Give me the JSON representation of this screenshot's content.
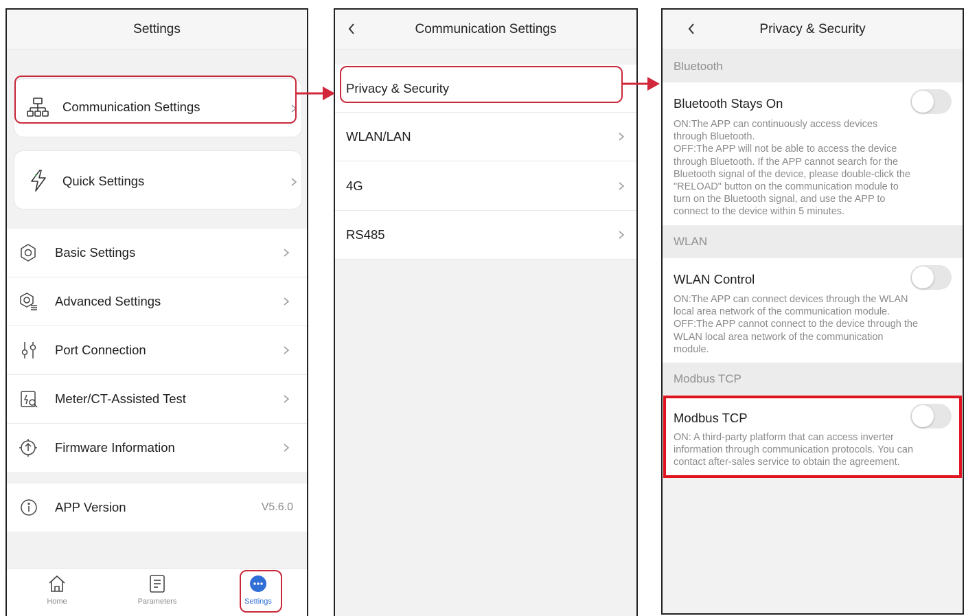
{
  "colors": {
    "highlight": "#c8283a",
    "accent": "#2f6fd6",
    "arrow": "#d2263a"
  },
  "screen1": {
    "title": "Settings",
    "card_items": [
      {
        "icon": "network-icon",
        "label": "Communication Settings"
      },
      {
        "icon": "lightning-icon",
        "label": "Quick Settings"
      }
    ],
    "list_items": [
      {
        "icon": "gear-icon",
        "label": "Basic Settings"
      },
      {
        "icon": "advanced-gear-icon",
        "label": "Advanced Settings"
      },
      {
        "icon": "port-connection-icon",
        "label": "Port Connection"
      },
      {
        "icon": "meter-test-icon",
        "label": "Meter/CT-Assisted Test"
      },
      {
        "icon": "firmware-icon",
        "label": "Firmware Information"
      }
    ],
    "app_version": {
      "label": "APP Version",
      "value": "V5.6.0"
    },
    "tabs": [
      {
        "icon": "home-icon",
        "label": "Home",
        "active": false
      },
      {
        "icon": "parameters-icon",
        "label": "Parameters",
        "active": false
      },
      {
        "icon": "settings-dots-icon",
        "label": "Settings",
        "active": true
      }
    ]
  },
  "screen2": {
    "title": "Communication Settings",
    "items": [
      "Privacy & Security",
      "WLAN/LAN",
      "4G",
      "RS485"
    ]
  },
  "screen3": {
    "title": "Privacy & Security",
    "sections": [
      {
        "header": "Bluetooth",
        "title": "Bluetooth Stays On",
        "toggle_on": false,
        "description": "ON:The APP can continuously access devices\nthrough Bluetooth.\nOFF:The APP will not be able to access the device\nthrough Bluetooth. If the APP cannot search for the\nBluetooth signal of the device, please double-click the\n\"RELOAD\" button on the communication module to\nturn on the Bluetooth signal, and use the APP to\nconnect to the device within 5 minutes."
      },
      {
        "header": "WLAN",
        "title": "WLAN Control",
        "toggle_on": false,
        "description": "ON:The APP can connect devices through the WLAN\nlocal area network of the communication module.\nOFF:The APP cannot connect to the device through the\nWLAN local area network of the communication\nmodule."
      },
      {
        "header": "Modbus TCP",
        "title": "Modbus TCP",
        "toggle_on": false,
        "description": "ON: A third-party platform that can access inverter\ninformation through communication protocols. You can\ncontact after-sales service to obtain the agreement."
      }
    ]
  }
}
